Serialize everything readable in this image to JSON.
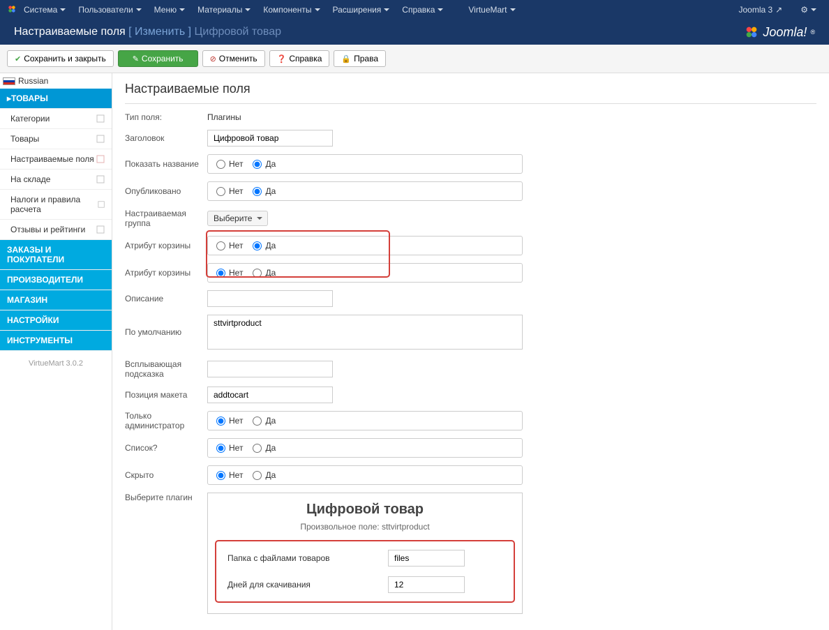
{
  "topbar": {
    "menus": [
      "Система",
      "Пользователи",
      "Меню",
      "Материалы",
      "Компоненты",
      "Расширения",
      "Справка"
    ],
    "vm": "VirtueMart",
    "joomla": "Joomla 3"
  },
  "header": {
    "title": "Настраиваемые поля",
    "edit": "[ Изменить ]",
    "sub": "Цифровой товар",
    "logo": "Joomla!"
  },
  "toolbar": {
    "save_close": "Сохранить и закрыть",
    "save": "Сохранить",
    "cancel": "Отменить",
    "help": "Справка",
    "rights": "Права"
  },
  "sidebar": {
    "lang": "Russian",
    "products": "ТОВАРЫ",
    "items": [
      "Категории",
      "Товары",
      "Настраиваемые поля",
      "На складе",
      "Налоги и правила расчета",
      "Отзывы и рейтинги"
    ],
    "cats": [
      "ЗАКАЗЫ И ПОКУПАТЕЛИ",
      "ПРОИЗВОДИТЕЛИ",
      "МАГАЗИН",
      "НАСТРОЙКИ",
      "ИНСТРУМЕНТЫ"
    ],
    "ver": "VirtueMart 3.0.2"
  },
  "page": {
    "heading": "Настраиваемые поля"
  },
  "labels": {
    "type": "Тип поля:",
    "title": "Заголовок",
    "show_title": "Показать название",
    "published": "Опубликовано",
    "group": "Настраиваемая группа",
    "cart_attr1": "Атрибут корзины",
    "cart_attr2": "Атрибут корзины",
    "desc": "Описание",
    "default": "По умолчанию",
    "tooltip": "Всплывающая подсказка",
    "layout": "Позиция макета",
    "admin_only": "Только администратор",
    "is_list": "Список?",
    "hidden": "Скрыто",
    "select_plugin": "Выберите плагин"
  },
  "values": {
    "type": "Плагины",
    "title": "Цифровой товар",
    "group": "Выберите",
    "default": "sttvirtproduct",
    "layout": "addtocart"
  },
  "radio": {
    "no": "Нет",
    "yes": "Да"
  },
  "plugin": {
    "title": "Цифровой товар",
    "sub": "Произвольное поле: sttvirtproduct",
    "folder_lbl": "Папка с файлами товаров",
    "folder_val": "files",
    "days_lbl": "Дней для скачивания",
    "days_val": "12"
  }
}
